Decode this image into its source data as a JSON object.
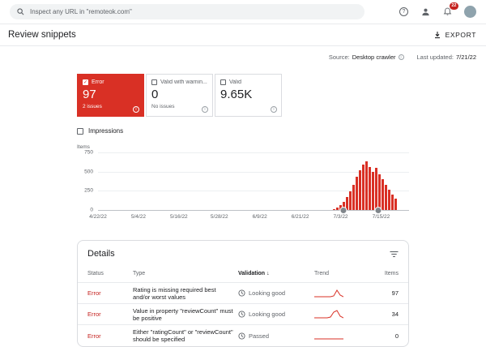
{
  "icons": {
    "help": "?",
    "info": "i",
    "check": "✓",
    "sort_desc": "↓"
  },
  "topbar": {
    "search_placeholder": "Inspect any URL in \"remoteok.com\"",
    "notification_count": "22"
  },
  "page": {
    "title": "Review snippets",
    "export_label": "EXPORT",
    "source_label": "Source:",
    "source_value": "Desktop crawler",
    "last_updated_label": "Last updated:",
    "last_updated_value": "7/21/22"
  },
  "cards": [
    {
      "label": "Error",
      "value": "97",
      "sub": "2 issues",
      "selected": true
    },
    {
      "label": "Valid with warnin...",
      "value": "0",
      "sub": "No issues",
      "selected": false
    },
    {
      "label": "Valid",
      "value": "9.65K",
      "sub": "",
      "selected": false
    }
  ],
  "impressions_label": "Impressions",
  "chart_data": {
    "type": "bar",
    "title": "",
    "ylabel": "Items",
    "ylim": [
      0,
      750
    ],
    "yticks": [
      750,
      500,
      250,
      0
    ],
    "grid": true,
    "x_labels": [
      "4/22/22",
      "5/4/22",
      "5/16/22",
      "5/28/22",
      "6/9/22",
      "6/21/22",
      "7/3/22",
      "7/15/22"
    ],
    "series": [
      {
        "name": "Error",
        "color": "#d93025",
        "start_fraction": 0.755,
        "values": [
          15,
          30,
          60,
          110,
          170,
          240,
          330,
          430,
          520,
          590,
          630,
          560,
          500,
          545,
          470,
          400,
          330,
          260,
          200,
          150
        ]
      }
    ],
    "markers": [
      {
        "fraction": 0.79
      },
      {
        "fraction": 0.9
      }
    ]
  },
  "details": {
    "title": "Details",
    "columns": {
      "status": "Status",
      "type": "Type",
      "validation": "Validation",
      "trend": "Trend",
      "items": "Items"
    },
    "rows": [
      {
        "status": "Error",
        "type": "Rating is missing required best and/or worst values",
        "validation": "Looking good",
        "items": "97",
        "trend": [
          1,
          1,
          1,
          1,
          1,
          1,
          2,
          9,
          3,
          1
        ]
      },
      {
        "status": "Error",
        "type": "Value in property \"reviewCount\" must be positive",
        "validation": "Looking good",
        "items": "34",
        "trend": [
          1,
          1,
          1,
          1,
          1,
          2,
          8,
          10,
          3,
          1
        ]
      },
      {
        "status": "Error",
        "type": "Either \"ratingCount\" or \"reviewCount\" should be specified",
        "validation": "Passed",
        "items": "0",
        "trend": [
          1,
          1,
          1,
          1,
          1,
          1,
          1,
          1,
          1,
          1
        ]
      }
    ]
  }
}
